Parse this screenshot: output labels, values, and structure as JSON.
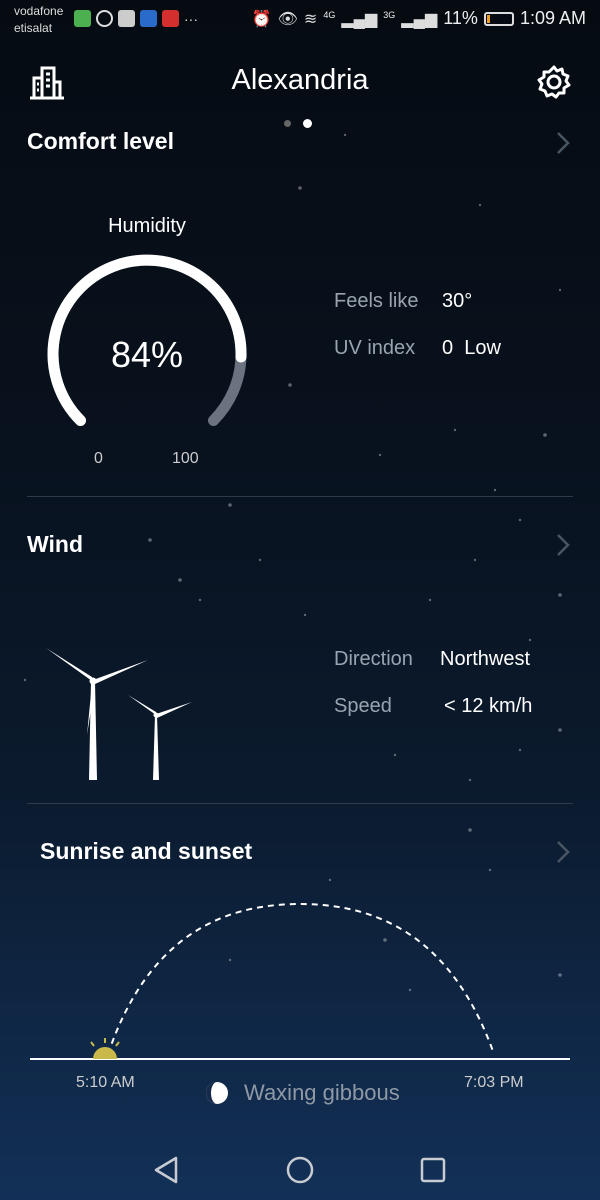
{
  "status_bar": {
    "carrier_1": "vodafone",
    "carrier_2": "etisalat",
    "more": "···",
    "net_1": "4G",
    "net_2": "3G",
    "battery": "11%",
    "battery_level": 0.11,
    "time": "1:09 AM",
    "notification_icons": [
      "messenger-icon",
      "whatsapp-icon",
      "stack-icon",
      "app-icon",
      "app-icon"
    ],
    "colors": {
      "accent_battery": "#f0a020"
    }
  },
  "header": {
    "city": "Alexandria",
    "left_icon": "city-buildings-icon",
    "right_icon": "gear-icon",
    "page_indicator": {
      "count": 2,
      "active": 1
    }
  },
  "comfort": {
    "title": "Comfort level",
    "humidity_label": "Humidity",
    "humidity_value": "84%",
    "humidity_level": 0.84,
    "min_label": "0",
    "max_label": "100",
    "feels_like_label": "Feels like",
    "feels_like_value": "30°",
    "uv_label": "UV index",
    "uv_value": "0  Low"
  },
  "wind": {
    "title": "Wind",
    "direction_label": "Direction",
    "direction_value": "Northwest",
    "speed_label": "Speed",
    "speed_value": "< 12 km/h",
    "icon": "wind-turbine-icon"
  },
  "sun": {
    "title": "Sunrise and sunset",
    "sunrise": "5:10 AM",
    "sunset": "7:03 PM",
    "moon_phase": "Waxing gibbous",
    "sun_progress": 0.0
  },
  "nav": {
    "back_icon": "back-triangle-icon",
    "home_icon": "home-circle-icon",
    "recents_icon": "recents-square-icon"
  }
}
